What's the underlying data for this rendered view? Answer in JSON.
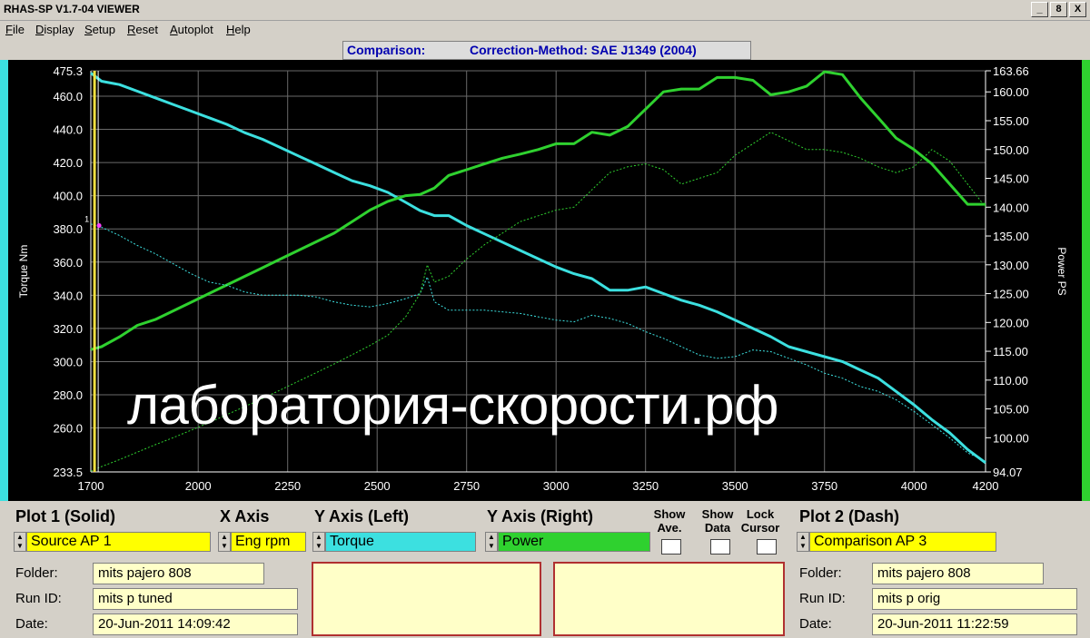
{
  "window": {
    "title": "RHAS-SP V1.7-04  VIEWER",
    "min_label": "_",
    "max_label": "8",
    "close_label": "X"
  },
  "menu": [
    {
      "u": "F",
      "rest": "ile"
    },
    {
      "u": "D",
      "rest": "isplay"
    },
    {
      "u": "S",
      "rest": "etup"
    },
    {
      "u": "R",
      "rest": "eset"
    },
    {
      "u": "A",
      "rest": "utoplot"
    },
    {
      "u": "H",
      "rest": "elp"
    }
  ],
  "comparison": {
    "label": "Comparison:",
    "method": "Correction-Method: SAE J1349 (2004)"
  },
  "watermark": "лаборатория-скорости.рф",
  "colors": {
    "torque": "#3ce0e0",
    "power": "#2fd12f",
    "cursor": "#f0e040",
    "plot_bg": "#000000"
  },
  "chart_data": {
    "type": "line",
    "xlabel": "",
    "ylabel": "Torque Nm",
    "y2label": "Power PS",
    "xlim": [
      1700,
      4200
    ],
    "ylim": [
      233.5,
      475.3
    ],
    "y2lim": [
      94.07,
      163.66
    ],
    "x_ticks": [
      1700,
      2000,
      2250,
      2500,
      2750,
      3000,
      3250,
      3500,
      3750,
      4000,
      4200
    ],
    "y_ticks": [
      "475.3",
      "460.0",
      "440.0",
      "420.0",
      "400.0",
      "380.0",
      "360.0",
      "340.0",
      "320.0",
      "300.0",
      "280.0",
      "260.0",
      "233.5"
    ],
    "y2_ticks": [
      "163.66",
      "160.00",
      "155.00",
      "150.00",
      "145.00",
      "140.00",
      "135.00",
      "130.00",
      "125.00",
      "120.00",
      "115.00",
      "110.00",
      "105.00",
      "100.00",
      "94.07"
    ],
    "cursor_x": 1718,
    "cursor_marker": "1",
    "grid": true,
    "series": [
      {
        "axis": "left",
        "style": "solid",
        "color": "#3ce0e0",
        "x": [
          1700,
          1730,
          1780,
          1830,
          1880,
          1930,
          1980,
          2030,
          2080,
          2130,
          2180,
          2230,
          2280,
          2330,
          2380,
          2430,
          2480,
          2530,
          2580,
          2620,
          2660,
          2700,
          2750,
          2800,
          2850,
          2900,
          2950,
          3000,
          3050,
          3100,
          3150,
          3200,
          3250,
          3300,
          3350,
          3400,
          3450,
          3500,
          3550,
          3600,
          3650,
          3700,
          3750,
          3800,
          3850,
          3900,
          3950,
          4000,
          4050,
          4100,
          4150,
          4200
        ],
        "values": [
          474,
          469,
          467,
          463,
          459,
          455,
          451,
          447,
          443,
          438,
          434,
          429,
          424,
          419,
          414,
          409,
          406,
          402,
          396,
          391,
          388,
          388,
          382,
          377,
          372,
          367,
          362,
          357,
          353,
          350,
          343,
          343,
          345,
          341,
          337,
          334,
          330,
          325,
          320,
          315,
          309,
          306,
          303,
          300,
          295,
          290,
          282,
          274,
          265,
          257,
          247,
          239
        ]
      },
      {
        "axis": "right",
        "style": "solid",
        "color": "#2fd12f",
        "x": [
          1700,
          1730,
          1780,
          1830,
          1880,
          1930,
          1980,
          2030,
          2080,
          2130,
          2180,
          2230,
          2280,
          2330,
          2380,
          2430,
          2480,
          2530,
          2580,
          2620,
          2660,
          2700,
          2750,
          2800,
          2850,
          2900,
          2950,
          3000,
          3050,
          3100,
          3150,
          3200,
          3250,
          3300,
          3350,
          3400,
          3450,
          3500,
          3550,
          3600,
          3650,
          3700,
          3750,
          3800,
          3850,
          3900,
          3950,
          4000,
          4050,
          4100,
          4150,
          4200
        ],
        "values": [
          115.3,
          115.8,
          117.5,
          119.5,
          120.5,
          122,
          123.5,
          125,
          126.5,
          128,
          129.5,
          131,
          132.5,
          134,
          135.5,
          137.5,
          139.5,
          141,
          142,
          142.2,
          143.3,
          145.5,
          146.5,
          147.5,
          148.5,
          149.2,
          150,
          151,
          151,
          153,
          152.5,
          154,
          157,
          160,
          160.5,
          160.5,
          162.5,
          162.5,
          162,
          159.5,
          160,
          161,
          163.5,
          163,
          159,
          155.5,
          152,
          150,
          147.5,
          144,
          140.5,
          140.5
        ]
      },
      {
        "axis": "left",
        "style": "dash",
        "color": "#3ce0e0",
        "x": [
          1700,
          1730,
          1780,
          1830,
          1880,
          1930,
          1980,
          2030,
          2080,
          2130,
          2180,
          2230,
          2280,
          2330,
          2380,
          2430,
          2480,
          2530,
          2580,
          2620,
          2640,
          2660,
          2700,
          2750,
          2800,
          2850,
          2900,
          2950,
          3000,
          3050,
          3100,
          3150,
          3200,
          3250,
          3300,
          3350,
          3400,
          3450,
          3500,
          3550,
          3600,
          3650,
          3700,
          3750,
          3800,
          3850,
          3900,
          3950,
          4000,
          4050,
          4100,
          4150,
          4200
        ],
        "values": [
          383,
          381,
          376,
          370,
          365,
          359,
          353,
          348,
          346,
          342,
          340,
          340,
          340,
          339,
          336,
          334,
          333,
          335,
          338,
          341,
          351,
          336,
          331,
          331,
          331,
          330,
          329,
          327,
          325,
          324,
          328,
          326,
          323,
          318,
          314,
          309,
          304,
          302,
          303,
          307,
          306,
          302,
          298,
          293,
          290,
          285,
          282,
          277,
          270,
          262,
          254,
          245,
          240
        ]
      },
      {
        "axis": "right",
        "style": "dash",
        "color": "#2fd12f",
        "x": [
          1700,
          1730,
          1780,
          1830,
          1880,
          1930,
          1980,
          2030,
          2080,
          2130,
          2180,
          2230,
          2280,
          2330,
          2380,
          2430,
          2480,
          2530,
          2580,
          2620,
          2640,
          2660,
          2700,
          2750,
          2800,
          2850,
          2900,
          2950,
          3000,
          3050,
          3100,
          3150,
          3200,
          3250,
          3300,
          3350,
          3400,
          3450,
          3500,
          3550,
          3600,
          3650,
          3700,
          3750,
          3800,
          3850,
          3900,
          3950,
          4000,
          4050,
          4100,
          4150,
          4200
        ],
        "values": [
          94.2,
          95,
          96.2,
          97.5,
          98.8,
          100,
          101.3,
          102.6,
          104,
          105.4,
          106.8,
          108.3,
          109.8,
          111.3,
          112.8,
          114.4,
          116,
          117.8,
          121,
          125,
          130,
          127,
          128,
          131,
          133.5,
          135.5,
          137.5,
          138.5,
          139.5,
          140,
          143,
          146,
          147,
          147.5,
          146.5,
          144,
          145,
          146,
          149,
          151,
          153,
          151.5,
          150,
          150,
          149.5,
          148.5,
          147,
          146,
          147,
          150,
          148,
          144,
          140
        ]
      }
    ]
  },
  "bottom": {
    "plot1_title": "Plot 1 (Solid)",
    "xaxis_title": "X Axis",
    "yleft_title": "Y Axis (Left)",
    "yright_title": "Y Axis (Right)",
    "show_ave": "Show Ave.",
    "show_data": "Show Data",
    "lock_cursor": "Lock Cursor",
    "plot2_title": "Plot 2 (Dash)",
    "plot1_source": "Source AP 1",
    "xaxis_value": "Eng rpm",
    "yleft_value": "Torque",
    "yright_value": "Power",
    "plot2_source": "Comparison AP 3",
    "folder_label": "Folder:",
    "runid_label": "Run ID:",
    "date_label": "Date:",
    "plot1_folder": "mits pajero 808",
    "plot1_runid": "mits p tuned",
    "plot1_date": "20-Jun-2011  14:09:42",
    "plot2_folder": "mits pajero 808",
    "plot2_runid": "mits p orig",
    "plot2_date": "20-Jun-2011  11:22:59"
  }
}
